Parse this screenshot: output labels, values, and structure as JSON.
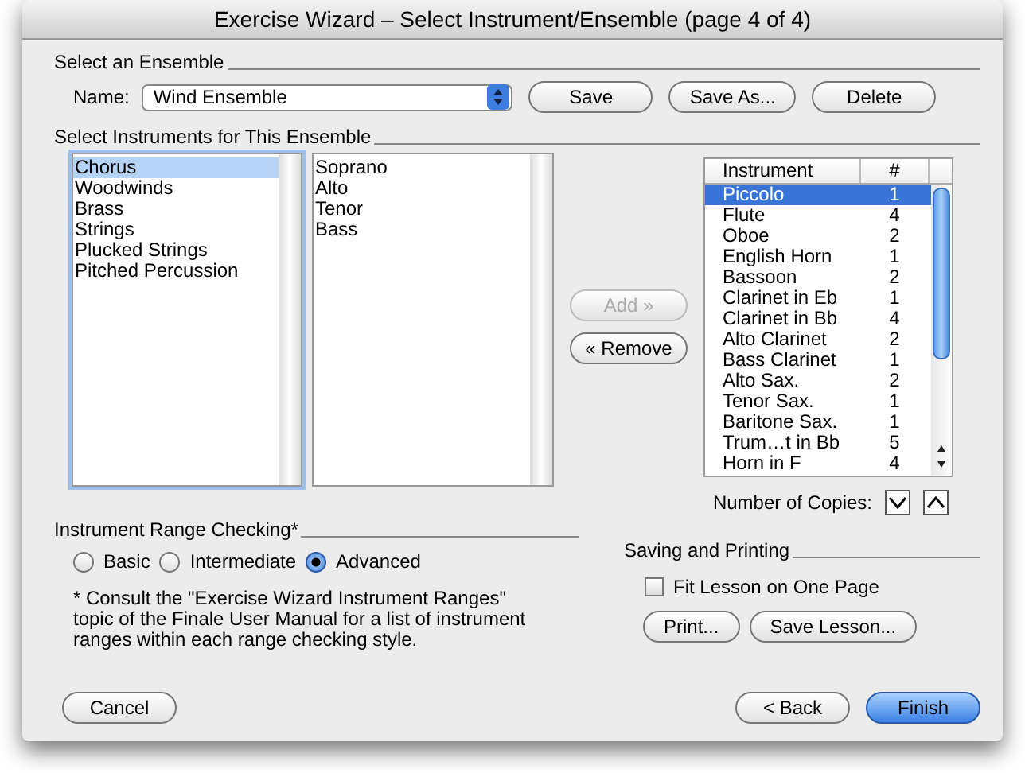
{
  "window": {
    "title": "Exercise Wizard – Select Instrument/Ensemble (page 4 of 4)"
  },
  "ensemble_section": {
    "heading": "Select an Ensemble",
    "name_label": "Name:",
    "name_value": "Wind Ensemble",
    "buttons": [
      {
        "label": "Save",
        "disabled": false
      },
      {
        "label": "Save As...",
        "disabled": false
      },
      {
        "label": "Delete",
        "disabled": false
      }
    ]
  },
  "instruments_section": {
    "heading": "Select Instruments for This Ensemble",
    "categories": [
      {
        "label": "Chorus",
        "selected": true
      },
      {
        "label": "Woodwinds",
        "selected": false
      },
      {
        "label": "Brass",
        "selected": false
      },
      {
        "label": "Strings",
        "selected": false
      },
      {
        "label": "Plucked Strings",
        "selected": false
      },
      {
        "label": "Pitched Percussion",
        "selected": false
      }
    ],
    "instruments": [
      {
        "label": "Soprano",
        "selected": false
      },
      {
        "label": "Alto",
        "selected": false
      },
      {
        "label": "Tenor",
        "selected": false
      },
      {
        "label": "Bass",
        "selected": false
      }
    ],
    "move_buttons": [
      {
        "label": "Add »",
        "disabled": true
      },
      {
        "label": "« Remove",
        "disabled": false
      }
    ],
    "table": {
      "columns": [
        "Instrument",
        "#"
      ],
      "rows": [
        {
          "instrument": "Piccolo",
          "count": "1",
          "selected": true
        },
        {
          "instrument": "Flute",
          "count": "4",
          "selected": false
        },
        {
          "instrument": "Oboe",
          "count": "2",
          "selected": false
        },
        {
          "instrument": "English Horn",
          "count": "1",
          "selected": false
        },
        {
          "instrument": "Bassoon",
          "count": "2",
          "selected": false
        },
        {
          "instrument": "Clarinet in Eb",
          "count": "1",
          "selected": false
        },
        {
          "instrument": "Clarinet in Bb",
          "count": "4",
          "selected": false
        },
        {
          "instrument": "Alto Clarinet",
          "count": "2",
          "selected": false
        },
        {
          "instrument": "Bass Clarinet",
          "count": "1",
          "selected": false
        },
        {
          "instrument": "Alto Sax.",
          "count": "2",
          "selected": false
        },
        {
          "instrument": "Tenor Sax.",
          "count": "1",
          "selected": false
        },
        {
          "instrument": "Baritone Sax.",
          "count": "1",
          "selected": false
        },
        {
          "instrument": "Trum…t in Bb",
          "count": "5",
          "selected": false
        },
        {
          "instrument": "Horn in F",
          "count": "4",
          "selected": false
        }
      ]
    },
    "copies_label": "Number of Copies:"
  },
  "range_checking": {
    "heading": "Instrument Range Checking*",
    "options": [
      {
        "label": "Basic",
        "selected": false
      },
      {
        "label": "Intermediate",
        "selected": false
      },
      {
        "label": "Advanced",
        "selected": true
      }
    ],
    "note": "* Consult the \"Exercise Wizard Instrument Ranges\" topic of the Finale User Manual for a list of instrument ranges within each range checking style."
  },
  "saving_printing": {
    "heading": "Saving and Printing",
    "fit_on_one_page": {
      "label": "Fit Lesson on One Page",
      "checked": false
    },
    "buttons": [
      {
        "label": "Print...",
        "disabled": false
      },
      {
        "label": "Save Lesson...",
        "disabled": false
      }
    ]
  },
  "footer_buttons": [
    {
      "label": "Cancel",
      "default": false
    },
    {
      "label": "< Back",
      "default": false
    },
    {
      "label": "Finish",
      "default": true
    }
  ]
}
